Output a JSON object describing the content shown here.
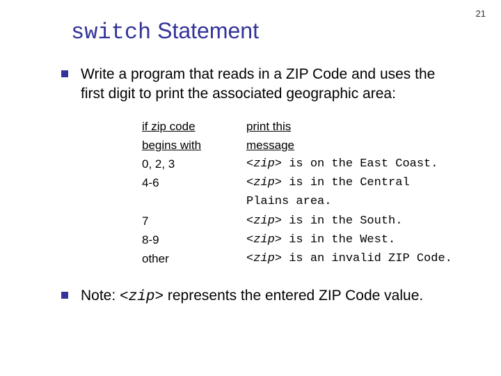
{
  "page_number": "21",
  "title": {
    "code": "switch",
    "rest": " Statement"
  },
  "bullet1": "Write a program that reads in a ZIP Code and uses the first digit to print the associated geographic area:",
  "table": {
    "head_zip_l1": "if zip code",
    "head_zip_l2": "begins with",
    "head_msg_l1": "print this",
    "head_msg_l2": "message",
    "rows": [
      {
        "zip": "0, 2, 3",
        "pre": "<zip>",
        "post": " is on the East Coast."
      },
      {
        "zip": "4-6",
        "pre": "<zip>",
        "post": " is in the Central Plains area."
      },
      {
        "zip": "7",
        "pre": "<zip>",
        "post": " is in the South."
      },
      {
        "zip": "8-9",
        "pre": "<zip>",
        "post": " is in the West."
      },
      {
        "zip": "other",
        "pre": "<zip>",
        "post": " is an invalid ZIP Code."
      }
    ]
  },
  "bullet2": {
    "pre": "Note: ",
    "zip": "<zip>",
    "post": " represents the entered ZIP Code value."
  }
}
